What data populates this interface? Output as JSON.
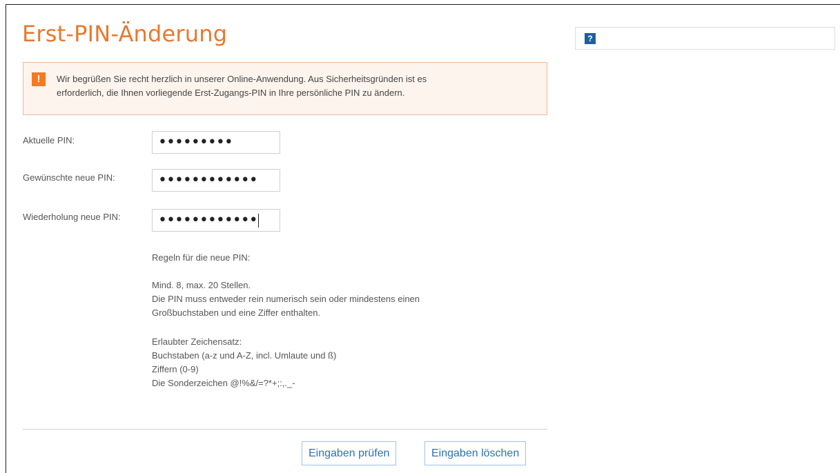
{
  "title": "Erst-PIN-Änderung",
  "notice": {
    "icon": "warning-icon",
    "icon_glyph": "!",
    "line1": "Wir begrüßen Sie recht herzlich in unserer Online-Anwendung. Aus Sicherheitsgründen ist es",
    "line2": "erforderlich, die Ihnen vorliegende Erst-Zugangs-PIN in Ihre persönliche PIN zu ändern."
  },
  "form": {
    "current_pin": {
      "label": "Aktuelle PIN:",
      "value": "•••••••••"
    },
    "new_pin": {
      "label": "Gewünschte neue PIN:",
      "value": "••••••••••••"
    },
    "repeat_pin": {
      "label": "Wiederholung neue PIN:",
      "value": "••••••••••••"
    }
  },
  "rules": {
    "heading": "Regeln für die neue PIN:",
    "length": "Mind. 8, max. 20 Stellen.",
    "composition_1": "Die PIN muss entweder rein numerisch sein oder mindestens einen",
    "composition_2": "Großbuchstaben und eine Ziffer enthalten.",
    "charset_heading": "Erlaubter Zeichensatz:",
    "charset_letters": "Buchstaben (a-z und A-Z, incl. Umlaute und ß)",
    "charset_digits": "Ziffern (0-9)",
    "charset_special": "Die Sonderzeichen @!%&/=?*+;:,._-"
  },
  "buttons": {
    "check": "Eingaben prüfen",
    "clear": "Eingaben löschen"
  },
  "help": {
    "icon": "help-icon",
    "glyph": "?"
  },
  "colors": {
    "title": "#e8782e",
    "notice_icon": "#f27b22",
    "button_text": "#2b72b6",
    "help_icon": "#1f5f9e"
  }
}
